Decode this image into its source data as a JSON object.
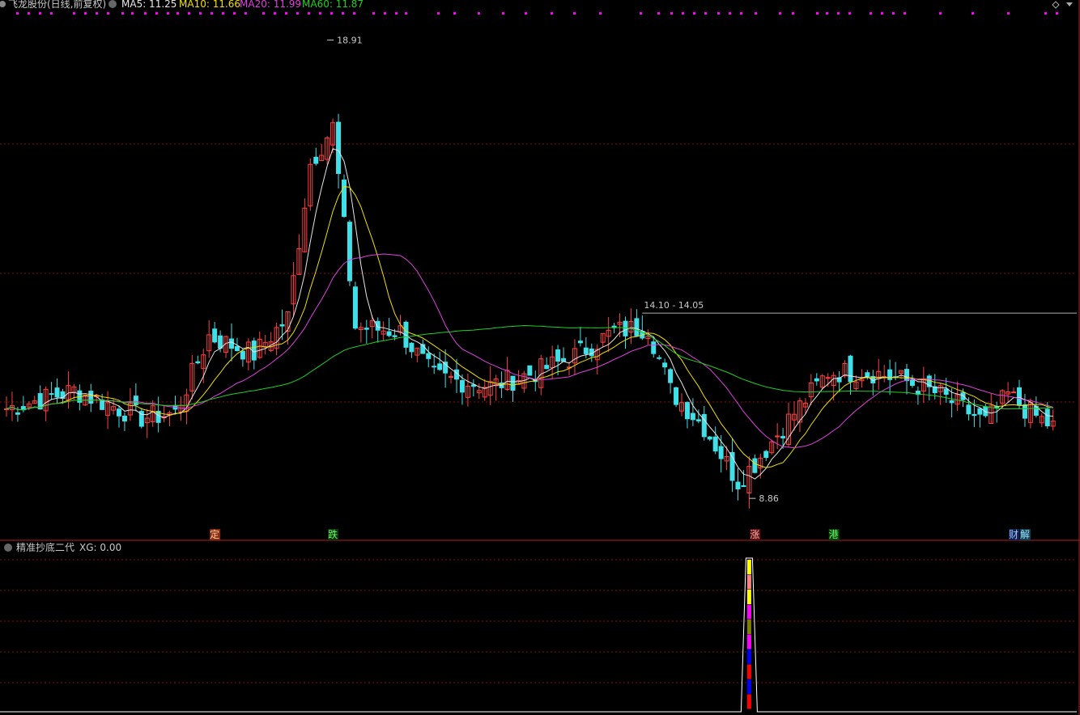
{
  "header": {
    "title": "飞龙股份(日线,前复权)",
    "ma_labels": [
      {
        "text": "MA5: 11.25",
        "color": "#e6e6e6"
      },
      {
        "text": "MA10: 11.66",
        "color": "#f0e000"
      },
      {
        "text": "MA20: 11.99",
        "color": "#e040e0"
      },
      {
        "text": "MA60: 11.87",
        "color": "#20d020"
      }
    ]
  },
  "indicator": {
    "title": "精准抄底二代",
    "value_text": "XG: 0.00"
  },
  "annotations": {
    "high_label": "18.91",
    "low_label": "8.86",
    "range_label": "14.10 - 14.05"
  },
  "event_markers": [
    {
      "text": "定",
      "bg": "#8a2a10",
      "fg": "#ffd0a0",
      "bar": 37
    },
    {
      "text": "跌",
      "bg": "#103010",
      "fg": "#60ff60",
      "bar": 58
    },
    {
      "text": "涨",
      "bg": "#5a1010",
      "fg": "#ffb0b0",
      "bar": 133
    },
    {
      "text": "港",
      "bg": "#104010",
      "fg": "#60ff60",
      "bar": 147
    },
    {
      "text": "财",
      "bg": "#102050",
      "fg": "#a0c0ff",
      "bar": 179
    },
    {
      "text": "解",
      "bg": "#104050",
      "fg": "#a0e0ff",
      "bar": 181
    }
  ],
  "colors": {
    "up": "#ff4040",
    "down": "#40e0e8",
    "ma5": "#e6e6e6",
    "ma10": "#f0e000",
    "ma20": "#e040e0",
    "ma60": "#20d020",
    "grid": "#8a1010",
    "marker_dots": "#ff00ff"
  },
  "chart_data": {
    "type": "candlestick",
    "ylim": [
      8.4,
      19.4
    ],
    "close_segments": [
      [
        0,
        10.8
      ],
      [
        12,
        11.2
      ],
      [
        24,
        10.6
      ],
      [
        30,
        10.7
      ],
      [
        36,
        12.4
      ],
      [
        44,
        12.0
      ],
      [
        50,
        12.8
      ],
      [
        54,
        16.2
      ],
      [
        58,
        17.0
      ],
      [
        62,
        12.6
      ],
      [
        70,
        12.5
      ],
      [
        76,
        11.5
      ],
      [
        86,
        11.3
      ],
      [
        94,
        11.6
      ],
      [
        100,
        11.9
      ],
      [
        108,
        12.5
      ],
      [
        114,
        12.6
      ],
      [
        118,
        11.2
      ],
      [
        124,
        10.4
      ],
      [
        130,
        9.2
      ],
      [
        133,
        9.6
      ],
      [
        138,
        10.4
      ],
      [
        146,
        11.6
      ],
      [
        154,
        11.6
      ],
      [
        160,
        11.4
      ],
      [
        166,
        11.1
      ],
      [
        174,
        10.5
      ],
      [
        178,
        11.1
      ],
      [
        182,
        10.7
      ],
      [
        186,
        10.4
      ]
    ],
    "ma_ranges": {
      "MA5": [
        8.9,
        17.0
      ],
      "MA10": [
        9.2,
        16.0
      ],
      "MA20": [
        10.4,
        14.2
      ],
      "MA60": [
        11.3,
        13.0
      ]
    },
    "indicator_signal": {
      "bar": 132,
      "xg_value": 0.0
    }
  }
}
